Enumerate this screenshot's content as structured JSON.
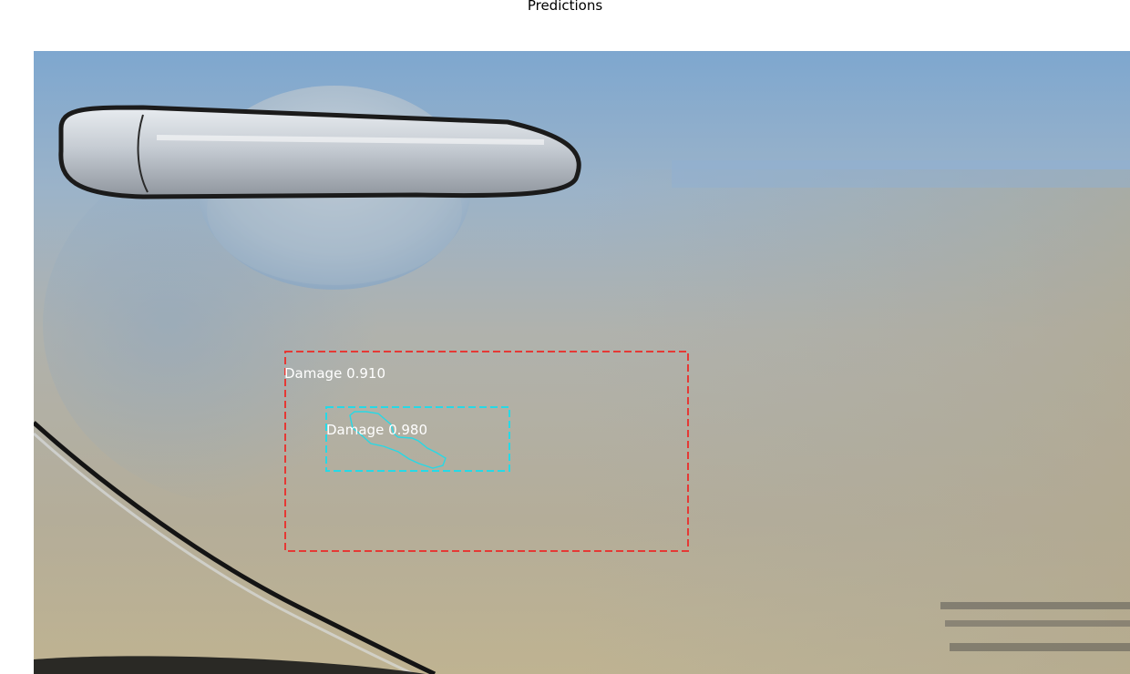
{
  "title": "Predictions",
  "detections": [
    {
      "label": "Damage 0.910",
      "color": "#e53935"
    },
    {
      "label": "Damage 0.980",
      "color": "#26d9e6"
    }
  ],
  "colors": {
    "sky": "#80a9cf",
    "body_panel": "#b4ae9c",
    "handle": "#c9d0d8",
    "panel_gap": "#141414"
  }
}
